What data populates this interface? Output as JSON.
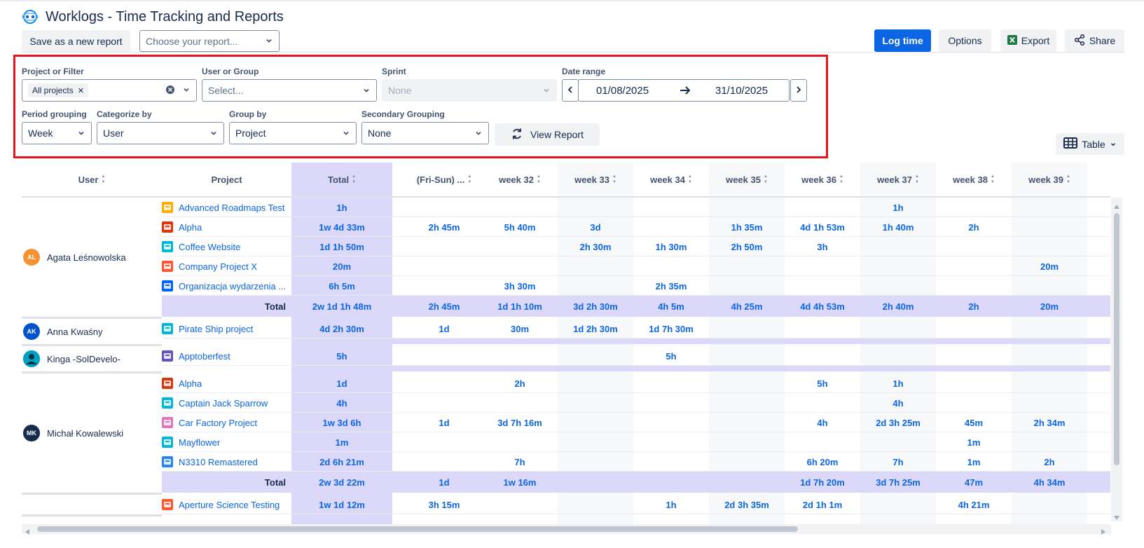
{
  "app": {
    "title": "Worklogs - Time Tracking and Reports"
  },
  "toolbar": {
    "save_report": "Save as a new report",
    "choose_report_placeholder": "Choose your report...",
    "log_time": "Log time",
    "options": "Options",
    "export": "Export",
    "share": "Share"
  },
  "filters": {
    "project_label": "Project or Filter",
    "project_tag": "All projects",
    "user_label": "User or Group",
    "user_placeholder": "Select...",
    "sprint_label": "Sprint",
    "sprint_value": "None",
    "date_label": "Date range",
    "date_from": "01/08/2025",
    "date_to": "31/10/2025",
    "period_label": "Period grouping",
    "period_value": "Week",
    "categorize_label": "Categorize by",
    "categorize_value": "User",
    "group_label": "Group by",
    "group_value": "Project",
    "secondary_label": "Secondary Grouping",
    "secondary_value": "None",
    "view_report": "View Report"
  },
  "view_toggle": "Table",
  "table": {
    "headers": [
      "User",
      "Project",
      "Total",
      "(Fri-Sun) ...",
      "week 32",
      "week 33",
      "week 34",
      "week 35",
      "week 36",
      "week 37",
      "week 38",
      "week 39"
    ],
    "total_label": "Total",
    "users": [
      {
        "name": "Agata Leśnowolska",
        "initials": "AL",
        "color": "#f79232",
        "rows": [
          {
            "project": "Advanced Roadmaps Test",
            "icon_color": "#ffab00",
            "total": "1h",
            "weeks": [
              "",
              "",
              "",
              "",
              "",
              "",
              "1h",
              "",
              ""
            ]
          },
          {
            "project": "Alpha",
            "icon_color": "#de350b",
            "total": "1w 4d 33m",
            "weeks": [
              "2h 45m",
              "5h 40m",
              "3d",
              "",
              "1h 35m",
              "4d 1h 53m",
              "1h 40m",
              "2h",
              ""
            ]
          },
          {
            "project": "Coffee Website",
            "icon_color": "#00b8d9",
            "total": "1d 1h 50m",
            "weeks": [
              "",
              "",
              "2h 30m",
              "1h 30m",
              "2h 50m",
              "3h",
              "",
              "",
              ""
            ]
          },
          {
            "project": "Company Project X",
            "icon_color": "#ff5630",
            "total": "20m",
            "weeks": [
              "",
              "",
              "",
              "",
              "",
              "",
              "",
              "",
              "20m"
            ]
          },
          {
            "project": "Organizacja wydarzenia ...",
            "icon_color": "#0065ff",
            "total": "6h 5m",
            "weeks": [
              "",
              "3h 30m",
              "",
              "2h 35m",
              "",
              "",
              "",
              "",
              ""
            ]
          }
        ],
        "totals": {
          "total": "2w 1d 1h 48m",
          "weeks": [
            "2h 45m",
            "1d 1h 10m",
            "3d 2h 30m",
            "4h 5m",
            "4h 25m",
            "4d 4h 53m",
            "2h 40m",
            "2h",
            "20m"
          ]
        }
      },
      {
        "name": "Anna Kwaśny",
        "initials": "AK",
        "color": "#0052cc",
        "rows": [
          {
            "project": "Pirate Ship project",
            "icon_color": "#00b8d9",
            "total": "4d 2h 30m",
            "weeks": [
              "1d",
              "30m",
              "1d 2h 30m",
              "1d 7h 30m",
              "",
              "",
              "",
              "",
              ""
            ]
          }
        ]
      },
      {
        "name": "Kinga -SolDevelo-",
        "initials": "",
        "color": "#00a3bf",
        "rows": [
          {
            "project": "Apptoberfest",
            "icon_color": "#6554c0",
            "total": "5h",
            "weeks": [
              "",
              "",
              "",
              "5h",
              "",
              "",
              "",
              "",
              ""
            ]
          }
        ]
      },
      {
        "name": "Michał Kowalewski",
        "initials": "MK",
        "color": "#172b4d",
        "rows": [
          {
            "project": "Alpha",
            "icon_color": "#de350b",
            "total": "1d",
            "weeks": [
              "",
              "2h",
              "",
              "",
              "",
              "5h",
              "1h",
              "",
              ""
            ]
          },
          {
            "project": "Captain Jack Sparrow",
            "icon_color": "#00b8d9",
            "total": "4h",
            "weeks": [
              "",
              "",
              "",
              "",
              "",
              "",
              "4h",
              "",
              ""
            ]
          },
          {
            "project": "Car Factory Project",
            "icon_color": "#e774bb",
            "total": "1w 3d 6h",
            "weeks": [
              "1d",
              "3d 7h 16m",
              "",
              "",
              "",
              "4h",
              "2d 3h 25m",
              "45m",
              "2h 34m"
            ]
          },
          {
            "project": "Mayflower",
            "icon_color": "#00b8d9",
            "total": "1m",
            "weeks": [
              "",
              "",
              "",
              "",
              "",
              "",
              "",
              "1m",
              ""
            ]
          },
          {
            "project": "N3310 Remastered",
            "icon_color": "#2684ff",
            "total": "2d 6h 21m",
            "weeks": [
              "",
              "7h",
              "",
              "",
              "",
              "6h 20m",
              "7h",
              "1m",
              "2h"
            ]
          }
        ],
        "totals": {
          "total": "2w 3d 22m",
          "weeks": [
            "1d",
            "1w 16m",
            "",
            "",
            "",
            "1d 7h 20m",
            "3d 7h 25m",
            "47m",
            "4h 34m"
          ]
        }
      },
      {
        "name": "",
        "initials": "",
        "color": "",
        "rows": [
          {
            "project": "Aperture Science Testing",
            "icon_color": "#ff5630",
            "total": "1w 1d 12m",
            "weeks": [
              "3h 15m",
              "",
              "",
              "1h",
              "2d 3h 35m",
              "2d 1h 1m",
              "",
              "4h 21m",
              ""
            ]
          }
        ]
      }
    ]
  }
}
